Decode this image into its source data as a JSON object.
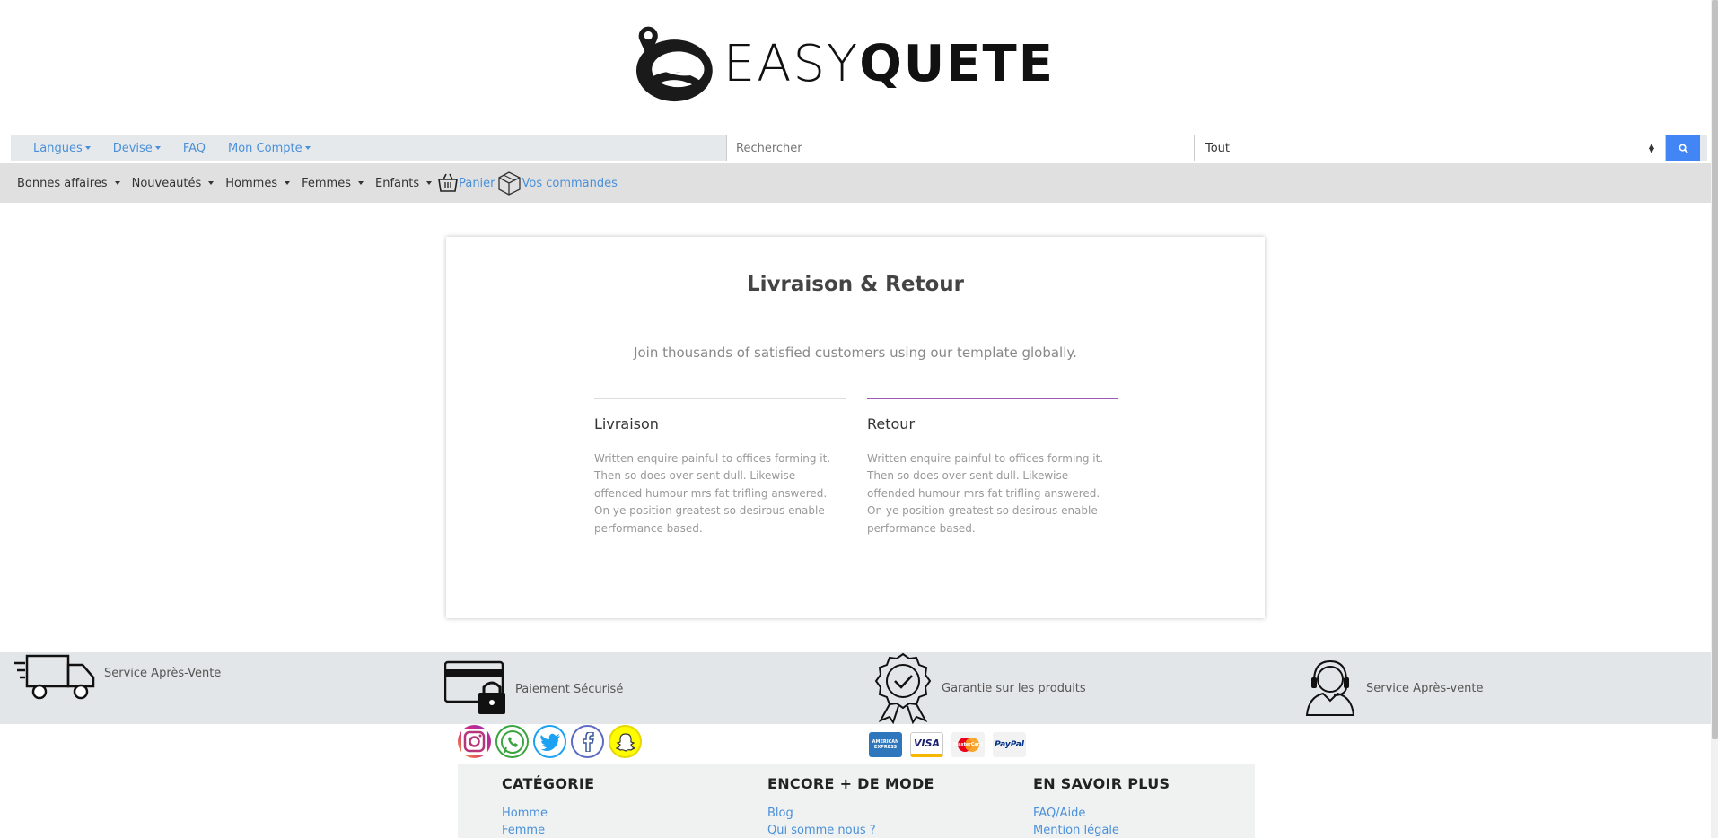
{
  "logo": {
    "text_thin": "EASY",
    "text_bold": "QUETE"
  },
  "topbar": {
    "languages": "Langues",
    "currency": "Devise",
    "faq": "FAQ",
    "account": "Mon Compte",
    "search_placeholder": "Rechercher",
    "category_select": "Tout"
  },
  "nav": {
    "items": [
      "Bonnes affaires",
      "Nouveautés",
      "Hommes",
      "Femmes",
      "Enfants"
    ],
    "cart": "Panier",
    "orders": "Vos commandes"
  },
  "card": {
    "title": "Livraison & Retour",
    "subtitle": "Join thousands of satisfied customers using our template globally.",
    "columns": [
      {
        "heading": "Livraison",
        "text": "Written enquire painful to offices forming it. Then so does over sent dull. Likewise offended humour mrs fat trifling answered. On ye position greatest so desirous enable performance based."
      },
      {
        "heading": "Retour",
        "text": "Written enquire painful to offices forming it. Then so does over sent dull. Likewise offended humour mrs fat trifling answered. On ye position greatest so desirous enable performance based."
      }
    ]
  },
  "features": [
    {
      "label": "Service Après-Vente",
      "icon": "delivery-truck-icon"
    },
    {
      "label": "Paiement Sécurisé",
      "icon": "secure-card-icon"
    },
    {
      "label": "Garantie sur les produits",
      "icon": "guarantee-badge-icon"
    },
    {
      "label": "Service Après-vente",
      "icon": "headset-agent-icon"
    }
  ],
  "social": [
    "instagram-icon",
    "whatsapp-icon",
    "twitter-icon",
    "facebook-icon",
    "snapchat-icon"
  ],
  "payments": {
    "amex": "AMERICAN EXPRESS",
    "visa": "VISA",
    "mastercard": "MasterCard",
    "paypal": "PayPal"
  },
  "footer": {
    "columns": [
      {
        "heading": "CATÉGORIE",
        "links": [
          "Homme",
          "Femme"
        ]
      },
      {
        "heading": "ENCORE + DE MODE",
        "links": [
          "Blog",
          "Qui somme nous ?"
        ]
      },
      {
        "heading": "EN SAVOIR PLUS",
        "links": [
          "FAQ/Aide",
          "Mention légale"
        ]
      }
    ]
  },
  "colors": {
    "link": "#4a90d9",
    "search_button": "#4285f4",
    "active_rule": "#9b59b6",
    "band": "#e3e6e8"
  }
}
